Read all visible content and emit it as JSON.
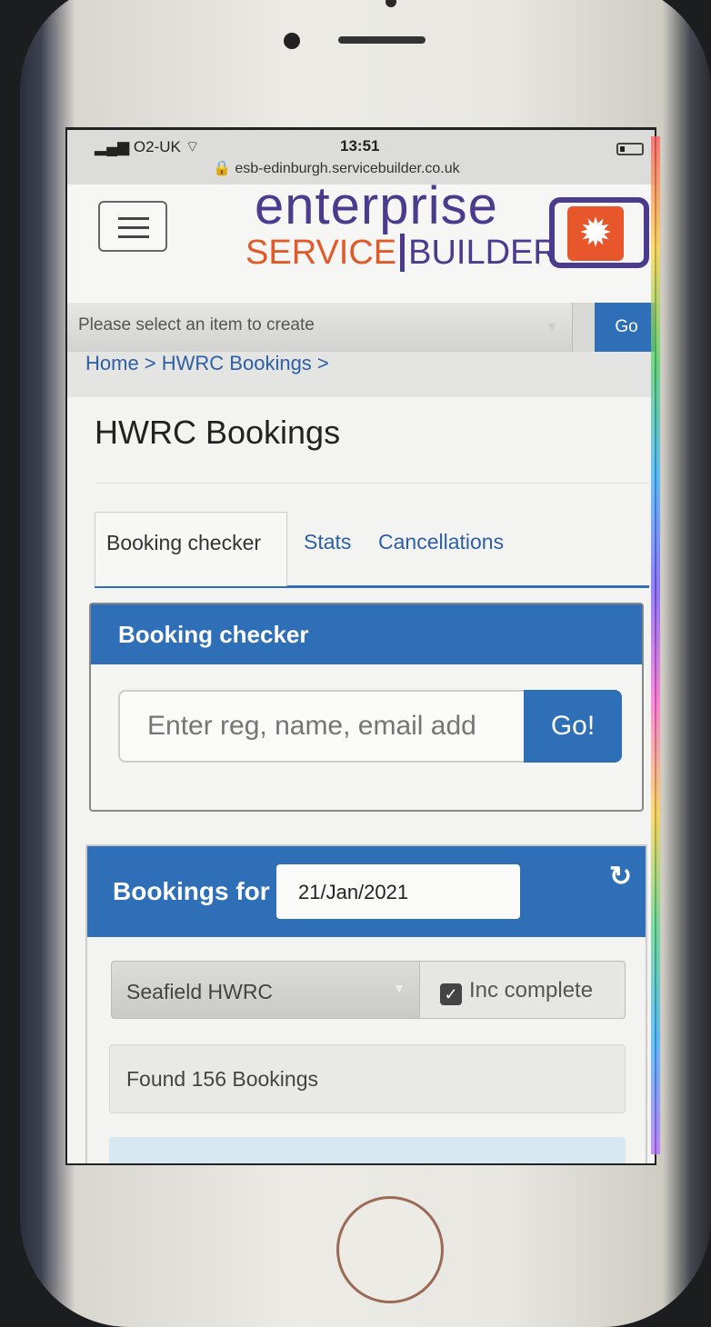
{
  "status_bar": {
    "carrier": "O2-UK",
    "time": "13:51",
    "url": "esb-edinburgh.servicebuilder.co.uk"
  },
  "header": {
    "logo_top": "enterprise",
    "logo_service": "SERVICE",
    "logo_builder": "BUILDER"
  },
  "create_bar": {
    "placeholder": "Please select an item to create",
    "go_label": "Go"
  },
  "breadcrumb": "Home > HWRC Bookings >",
  "page_title": "HWRC Bookings",
  "tabs": [
    {
      "label": "Booking checker",
      "active": true
    },
    {
      "label": "Stats",
      "active": false
    },
    {
      "label": "Cancellations",
      "active": false
    }
  ],
  "booking_checker": {
    "heading": "Booking checker",
    "search_placeholder": "Enter reg, name, email add",
    "go_label": "Go!"
  },
  "bookings_panel": {
    "heading": "Bookings for",
    "date": "21/Jan/2021",
    "site": "Seafield HWRC",
    "inc_complete_label": "Inc complete",
    "inc_complete_checked": true,
    "found_text": "Found 156 Bookings"
  },
  "colors": {
    "primary": "#2f6fb7",
    "logo_purple": "#4b3b8f",
    "logo_orange": "#e05a2a"
  }
}
